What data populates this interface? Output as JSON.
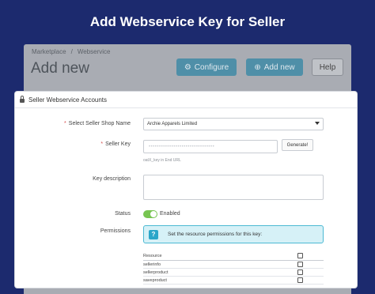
{
  "page_title": "Add Webservice Key for Seller",
  "breadcrumb": {
    "parent": "Marketplace",
    "separator": "/",
    "current": "Webservice"
  },
  "header": {
    "title": "Add new"
  },
  "toolbar": {
    "configure_label": "Configure",
    "add_new_label": "Add new",
    "help_label": "Help"
  },
  "panel": {
    "title": "Seller Webservice Accounts",
    "shop_label": "Select Seller Shop Name",
    "shop_value": "Archie Apparels Limited",
    "key_label": "Seller Key",
    "key_value": "••••••••••••••••••••••••••••••••",
    "generate_label": "Generate!",
    "key_hint": "oatX_key in End URL",
    "description_label": "Key description",
    "status_label": "Status",
    "status_value": "Enabled",
    "permissions_label": "Permissions",
    "permissions_info": "Set the resource permissions for this key:",
    "resource_header": "Resource",
    "resources": [
      "sellerinfo",
      "sellerproduct",
      "saveproduct"
    ]
  },
  "icons": {
    "configure": "gear-icon",
    "add_new": "plus-circle-icon",
    "panel": "lock-icon",
    "info": "question-icon"
  },
  "colors": {
    "background": "#1c2a6e",
    "accent": "#2ba6c9",
    "toggle_on": "#78c552",
    "required": "#d64d4d"
  }
}
